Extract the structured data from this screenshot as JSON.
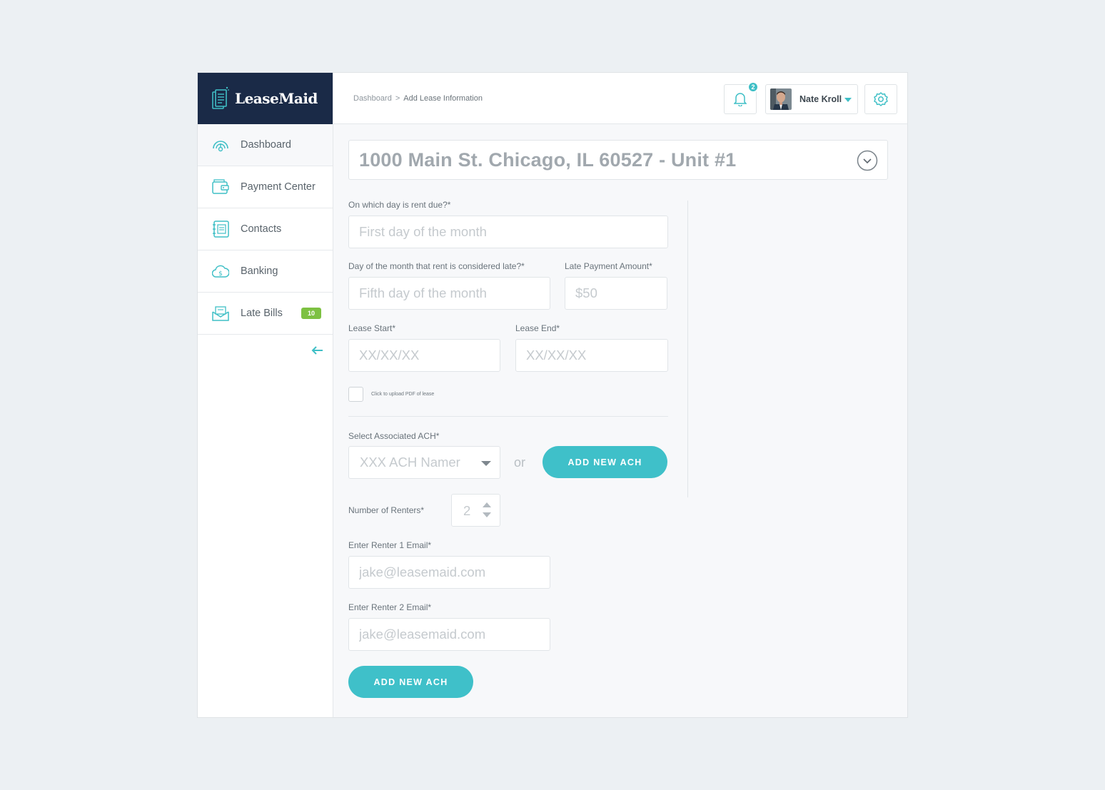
{
  "brand": {
    "name": "LeaseMaid"
  },
  "sidebar": {
    "items": [
      {
        "label": "Dashboard",
        "icon": "dashboard-icon"
      },
      {
        "label": "Payment Center",
        "icon": "wallet-icon"
      },
      {
        "label": "Contacts",
        "icon": "contacts-book-icon"
      },
      {
        "label": "Banking",
        "icon": "money-cloud-icon"
      },
      {
        "label": "Late Bills",
        "icon": "envelope-icon",
        "badge": "10"
      }
    ],
    "collapse_icon": "arrow-left-icon"
  },
  "header": {
    "breadcrumb": {
      "root": "Dashboard",
      "separator": ">",
      "current": "Add Lease Information"
    },
    "notifications": {
      "count": "2",
      "icon": "bell-icon"
    },
    "user": {
      "name": "Nate Kroll",
      "icon": "chevron-down-icon"
    },
    "settings_icon": "gear-icon"
  },
  "form": {
    "property": "1000 Main St. Chicago, IL 60527 - Unit #1",
    "rent_due": {
      "label": "On which day is rent due?*",
      "placeholder": "First day of the month"
    },
    "late_day": {
      "label": "Day of the month that rent is considered late?*",
      "placeholder": "Fifth day of the month"
    },
    "late_amount": {
      "label": "Late Payment Amount*",
      "placeholder": "$50"
    },
    "lease_start": {
      "label": "Lease Start*",
      "placeholder": "XX/XX/XX"
    },
    "lease_end": {
      "label": "Lease End*",
      "placeholder": "XX/XX/XX"
    },
    "upload_pdf": {
      "label": "Click to upload PDF of lease"
    },
    "ach": {
      "label": "Select Associated ACH*",
      "selected": "XXX ACH Namer",
      "or": "or",
      "add_button": "ADD NEW ACH"
    },
    "renters": {
      "label": "Number of Renters*",
      "value": "2"
    },
    "renter1_email": {
      "label": "Enter Renter 1 Email*",
      "placeholder": "jake@leasemaid.com"
    },
    "renter2_email": {
      "label": "Enter Renter 2 Email*",
      "placeholder": "jake@leasemaid.com"
    },
    "submit_button": "ADD NEW ACH"
  },
  "colors": {
    "accent": "#3fc0c9",
    "navy": "#1a2a47",
    "badge_green": "#7dc142"
  }
}
